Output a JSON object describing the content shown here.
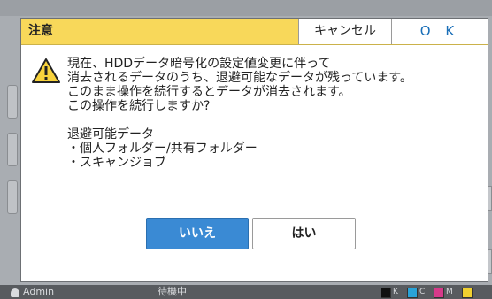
{
  "background": {
    "user": "Admin",
    "state": "待機中",
    "ink": [
      "K",
      "C",
      "M"
    ]
  },
  "dialog": {
    "title": "注意",
    "cancel_label": "キャンセル",
    "ok_label": "O K",
    "icon": "warning-icon",
    "message_lines": [
      "現在、HDDデータ暗号化の設定値変更に伴って",
      "消去されるデータのうち、退避可能なデータが残っています。",
      "このまま操作を続行するとデータが消去されます。",
      "この操作を続行しますか?"
    ],
    "detail_lines": [
      "退避可能データ",
      "・個人フォルダー/共有フォルダー",
      "・スキャンジョブ"
    ],
    "no_label": "いいえ",
    "yes_label": "はい"
  },
  "colors": {
    "title_bar": "#f8d85a",
    "primary_button": "#3a8ad4",
    "ok_text": "#1a6fb8",
    "warning_fill": "#f7d23c"
  }
}
